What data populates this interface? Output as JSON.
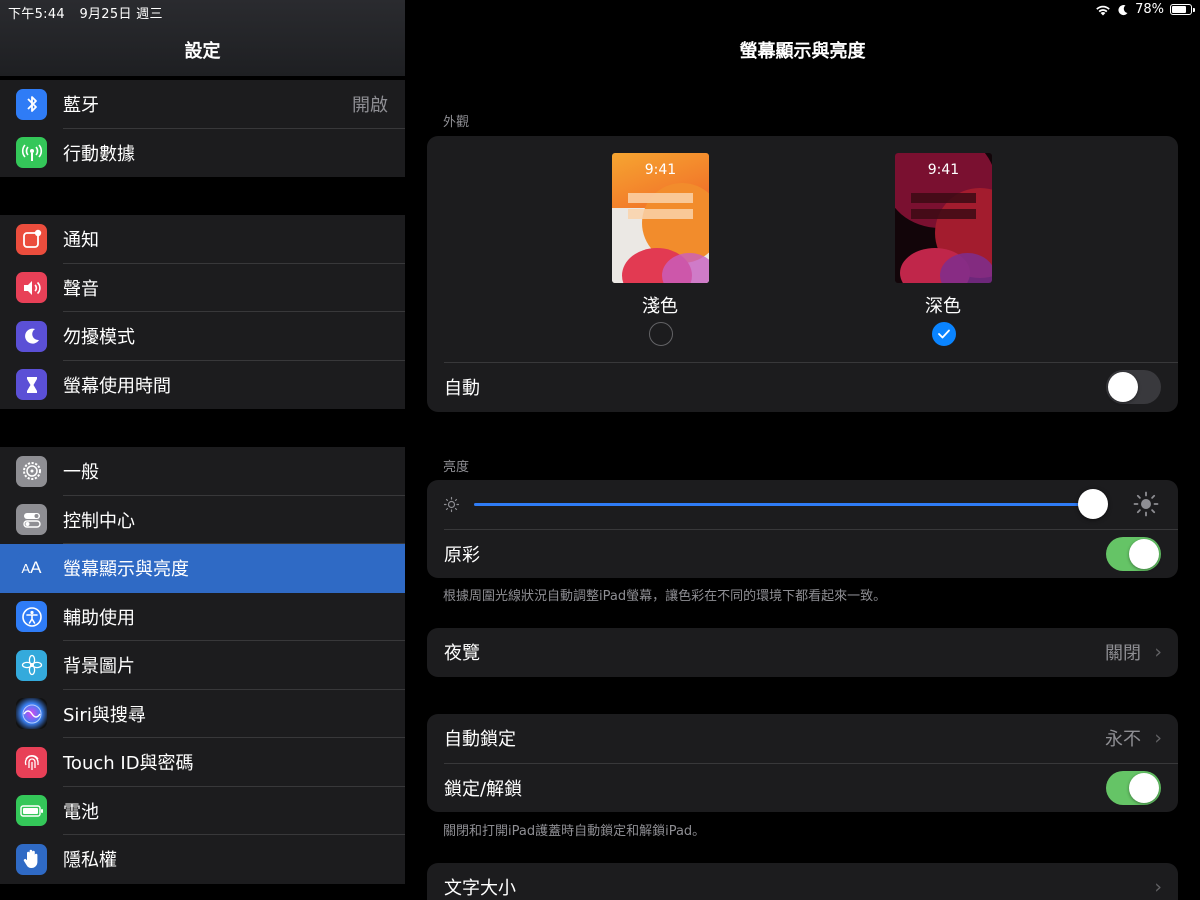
{
  "status_bar": {
    "time": "下午5:44",
    "date": "9月25日 週三",
    "battery": "78%",
    "battery_level": 0.78
  },
  "sidebar": {
    "title": "設定",
    "groups": [
      [
        {
          "label": "藍牙",
          "value": "開啟",
          "icon": "bluetooth-icon",
          "color": "#2f7cf6"
        },
        {
          "label": "行動數據",
          "icon": "antenna-icon",
          "color": "#34c759"
        }
      ],
      [
        {
          "label": "通知",
          "icon": "notifications-icon",
          "color": "#eb4d3d"
        },
        {
          "label": "聲音",
          "icon": "speaker-icon",
          "color": "#e84057"
        },
        {
          "label": "勿擾模式",
          "icon": "moon-icon",
          "color": "#5b50d6"
        },
        {
          "label": "螢幕使用時間",
          "icon": "hourglass-icon",
          "color": "#5b50d6"
        }
      ],
      [
        {
          "label": "一般",
          "icon": "gear-icon",
          "color": "#8e8e93"
        },
        {
          "label": "控制中心",
          "icon": "switches-icon",
          "color": "#8e8e93"
        },
        {
          "label": "螢幕顯示與亮度",
          "icon": "text-size-icon",
          "color": "#2f6ac5",
          "selected": true
        },
        {
          "label": "輔助使用",
          "icon": "accessibility-icon",
          "color": "#2f7cf6"
        },
        {
          "label": "背景圖片",
          "icon": "flower-icon",
          "color": "#34aadc"
        },
        {
          "label": "Siri與搜尋",
          "icon": "siri-icon",
          "color": "#1f1f3a"
        },
        {
          "label": "Touch ID與密碼",
          "icon": "fingerprint-icon",
          "color": "#e84057"
        },
        {
          "label": "電池",
          "icon": "battery-icon",
          "color": "#34c759"
        },
        {
          "label": "隱私權",
          "icon": "hand-icon",
          "color": "#2f6ac5"
        }
      ]
    ]
  },
  "detail": {
    "title": "螢幕顯示與亮度",
    "appearance": {
      "section_label": "外觀",
      "light": {
        "label": "淺色",
        "time": "9:41",
        "selected": false
      },
      "dark": {
        "label": "深色",
        "time": "9:41",
        "selected": true
      },
      "automatic": {
        "label": "自動",
        "on": false
      }
    },
    "brightness": {
      "section_label": "亮度",
      "level": 0.98,
      "true_tone": {
        "label": "原彩",
        "on": true
      },
      "note": "根據周圍光線狀況自動調整iPad螢幕，讓色彩在不同的環境下都看起來一致。"
    },
    "night_shift": {
      "label": "夜覽",
      "value": "關閉"
    },
    "auto_lock": {
      "label": "自動鎖定",
      "value": "永不"
    },
    "lock_unlock": {
      "label": "鎖定/解鎖",
      "on": true,
      "note": "關閉和打開iPad護蓋時自動鎖定和解鎖iPad。"
    },
    "text_size": {
      "label": "文字大小"
    }
  }
}
